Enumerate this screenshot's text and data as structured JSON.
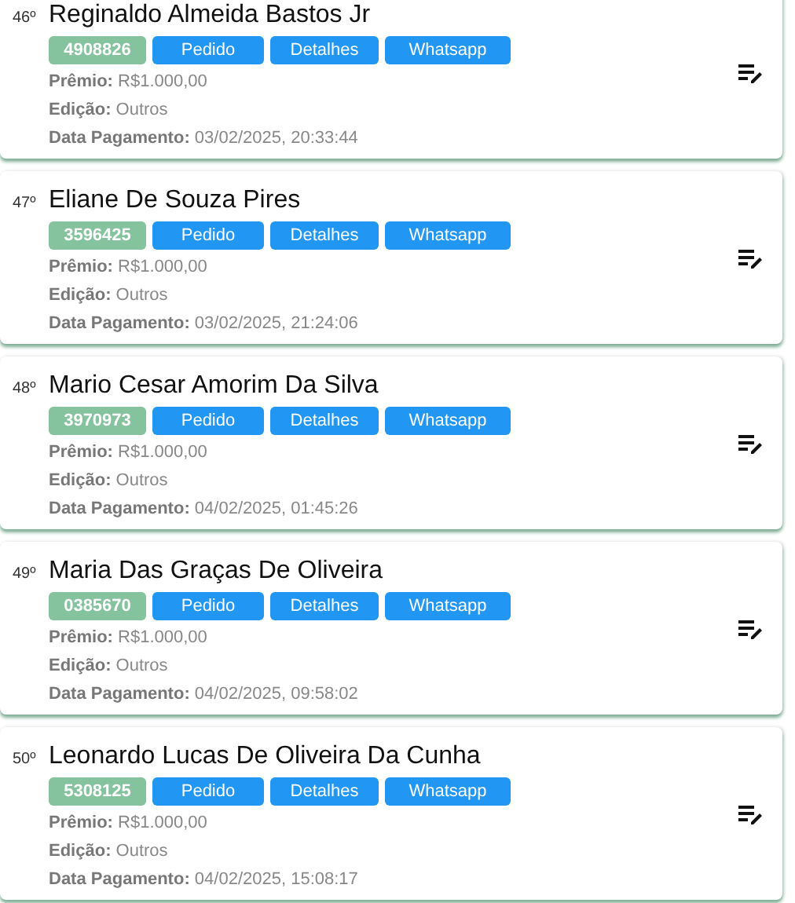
{
  "entries": [
    {
      "rank": "46º",
      "name": "Reginaldo Almeida Bastos Jr",
      "code": "4908826",
      "buttons": [
        "Pedido",
        "Detalhes",
        "Whatsapp"
      ],
      "details": [
        {
          "label": "Prêmio:",
          "value": "R$1.000,00"
        },
        {
          "label": "Edição:",
          "value": "Outros"
        },
        {
          "label": "Data Pagamento:",
          "value": "03/02/2025, 20:33:44"
        }
      ]
    },
    {
      "rank": "47º",
      "name": "Eliane De Souza Pires",
      "code": "3596425",
      "buttons": [
        "Pedido",
        "Detalhes",
        "Whatsapp"
      ],
      "details": [
        {
          "label": "Prêmio:",
          "value": "R$1.000,00"
        },
        {
          "label": "Edição:",
          "value": "Outros"
        },
        {
          "label": "Data Pagamento:",
          "value": "03/02/2025, 21:24:06"
        }
      ]
    },
    {
      "rank": "48º",
      "name": "Mario Cesar Amorim Da Silva",
      "code": "3970973",
      "buttons": [
        "Pedido",
        "Detalhes",
        "Whatsapp"
      ],
      "details": [
        {
          "label": "Prêmio:",
          "value": "R$1.000,00"
        },
        {
          "label": "Edição:",
          "value": "Outros"
        },
        {
          "label": "Data Pagamento:",
          "value": "04/02/2025, 01:45:26"
        }
      ]
    },
    {
      "rank": "49º",
      "name": "Maria Das Graças De Oliveira",
      "code": "0385670",
      "buttons": [
        "Pedido",
        "Detalhes",
        "Whatsapp"
      ],
      "details": [
        {
          "label": "Prêmio:",
          "value": "R$1.000,00"
        },
        {
          "label": "Edição:",
          "value": "Outros"
        },
        {
          "label": "Data Pagamento:",
          "value": "04/02/2025, 09:58:02"
        }
      ]
    },
    {
      "rank": "50º",
      "name": "Leonardo Lucas De Oliveira Da Cunha",
      "code": "5308125",
      "buttons": [
        "Pedido",
        "Detalhes",
        "Whatsapp"
      ],
      "details": [
        {
          "label": "Prêmio:",
          "value": "R$1.000,00"
        },
        {
          "label": "Edição:",
          "value": "Outros"
        },
        {
          "label": "Data Pagamento:",
          "value": "04/02/2025, 15:08:17"
        }
      ]
    }
  ]
}
